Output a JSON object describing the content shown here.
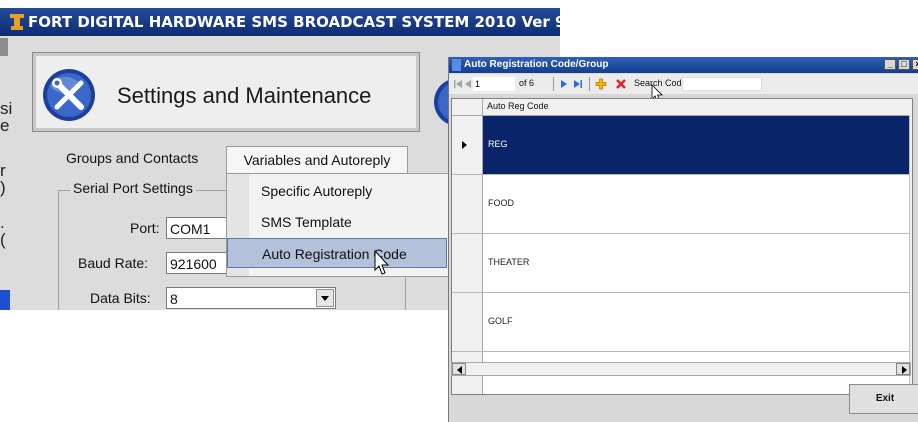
{
  "app": {
    "title": "FORT DIGITAL HARDWARE SMS BROADCAST SYSTEM 2010 Ver 9",
    "banner_title": "Settings and Maintenance",
    "cut_letters": [
      "si",
      "e",
      "r",
      ")",
      ".",
      "("
    ],
    "tabs": [
      {
        "label": "Groups and Contacts"
      },
      {
        "label": "Variables and Autoreply"
      }
    ],
    "serial": {
      "legend": "Serial Port Settings",
      "port_label": "Port:",
      "port_value": "COM1",
      "baud_label": "Baud Rate:",
      "baud_value": "921600",
      "databits_label": "Data Bits:",
      "databits_value": "8"
    },
    "menu": [
      {
        "label": "Specific Autoreply"
      },
      {
        "label": "SMS Template"
      },
      {
        "label": "Auto Registration Code"
      }
    ],
    "colors": {
      "title_bar": "#0e2c74",
      "menu_highlight": "#b3c1da"
    }
  },
  "dialog": {
    "title": "Auto Registration Code/Group",
    "nav": {
      "position": "1",
      "total": "of 6",
      "search_label": "Search Code",
      "search_value": ""
    },
    "grid": {
      "column_header": "Auto Reg Code",
      "rows": [
        "REG",
        "FOOD",
        "THEATER",
        "GOLF"
      ],
      "selected_index": 0
    },
    "exit_label": "Exit",
    "colors": {
      "selected_row": "#0a246a",
      "title_bar": "#2f5fb8"
    }
  }
}
